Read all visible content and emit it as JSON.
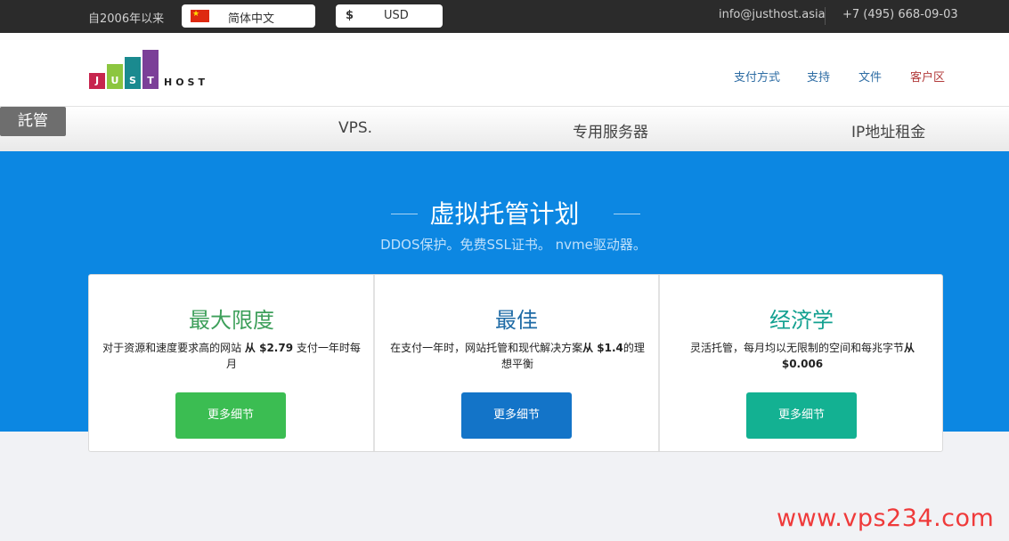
{
  "topbar": {
    "since": "自2006年以来",
    "language": "简体中文",
    "currency_symbol": "$",
    "currency_code": "USD",
    "email": "info@justhost.asia",
    "phone": "+7 (495) 668-09-03"
  },
  "logo": {
    "letters": [
      "J",
      "U",
      "S",
      "T"
    ],
    "host": "HOST"
  },
  "header_nav": [
    "支付方式",
    "支持",
    "文件",
    "客户区"
  ],
  "main_nav": {
    "items": [
      "託管",
      "VPS.",
      "专用服务器",
      "IP地址租金"
    ],
    "active": "託管"
  },
  "hero": {
    "title": "虚拟托管计划",
    "subtitle": "DDOS保护。免费SSL证书。 nvme驱动器。"
  },
  "plans": [
    {
      "title": "最大限度",
      "desc_pre": "对于资源和速度要求高的网站 ",
      "desc_bold": "从 $2.79",
      "desc_post": " 支付一年时每月",
      "button": "更多细节",
      "color": "#3bbd52"
    },
    {
      "title": "最佳",
      "desc_pre": "在支付一年时，网站托管和现代解决方案",
      "desc_bold": "从 $1.4",
      "desc_post": "的理想平衡",
      "button": "更多细节",
      "color": "#1374c8"
    },
    {
      "title": "经济学",
      "desc_pre": "灵活托管，每月均以无限制的空间和每兆字节",
      "desc_bold": "从 $0.006",
      "desc_post": "",
      "button": "更多细节",
      "color": "#13b192"
    }
  ],
  "watermark": "www.vps234.com"
}
